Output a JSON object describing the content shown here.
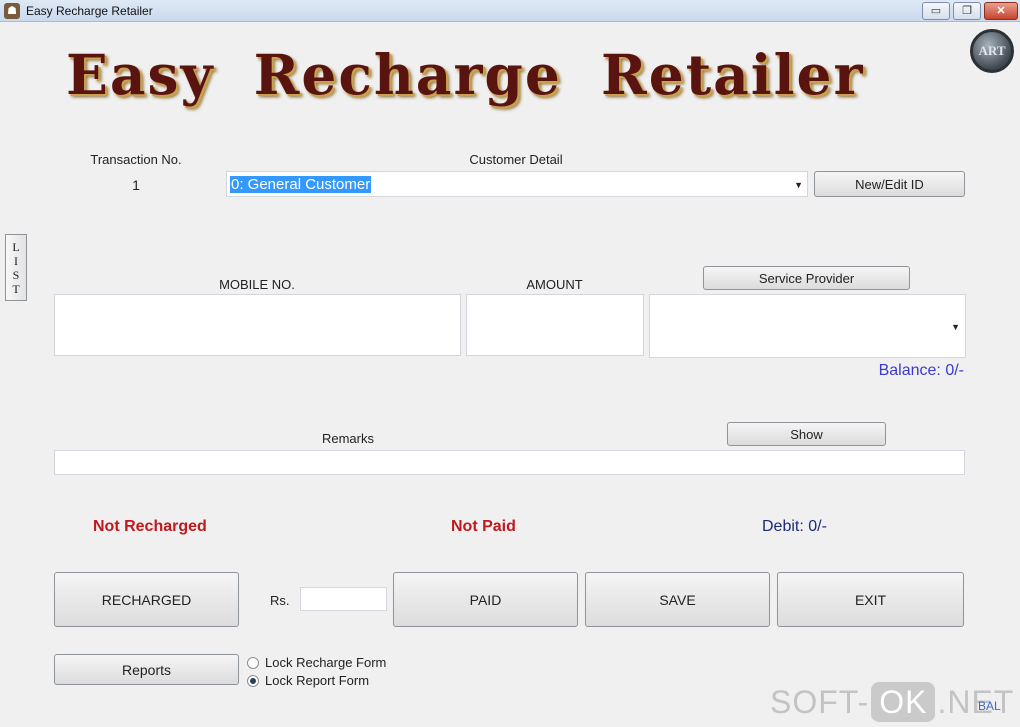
{
  "window": {
    "title": "Easy Recharge Retailer",
    "minimize": "▭",
    "maximize": "❐",
    "close": "✕"
  },
  "badge": {
    "text": "ART"
  },
  "heading": "Easy Recharge Retailer",
  "transaction": {
    "label": "Transaction No.",
    "value": "1"
  },
  "customer": {
    "label": "Customer Detail",
    "selected": "0: General Customer",
    "new_edit_label": "New/Edit ID"
  },
  "list_tab": [
    "L",
    "I",
    "S",
    "T"
  ],
  "mobile": {
    "label": "MOBILE NO.",
    "value": ""
  },
  "amount": {
    "label": "AMOUNT",
    "value": ""
  },
  "provider": {
    "button_label": "Service Provider",
    "selected": ""
  },
  "balance": {
    "text": "Balance: 0/-"
  },
  "remarks": {
    "label": "Remarks",
    "value": "",
    "show_label": "Show"
  },
  "status": {
    "recharge": "Not Recharged",
    "payment": "Not Paid",
    "debit": "Debit: 0/-"
  },
  "actions": {
    "recharged": "RECHARGED",
    "rs_label": "Rs.",
    "rs_value": "",
    "paid": "PAID",
    "save": "SAVE",
    "exit": "EXIT",
    "reports": "Reports"
  },
  "lock_options": [
    {
      "label": "Lock Recharge Form",
      "selected": false
    },
    {
      "label": "Lock Report Form",
      "selected": true
    }
  ],
  "corner_text": "BAL",
  "watermark": {
    "left": "SOFT-",
    "ok": "OK",
    "right": ".NET"
  },
  "colors": {
    "heading": "#5a1410",
    "status_red": "#c0181d",
    "balance": "#3a3ad0",
    "debit": "#1e2a78",
    "selection": "#3399ff"
  }
}
